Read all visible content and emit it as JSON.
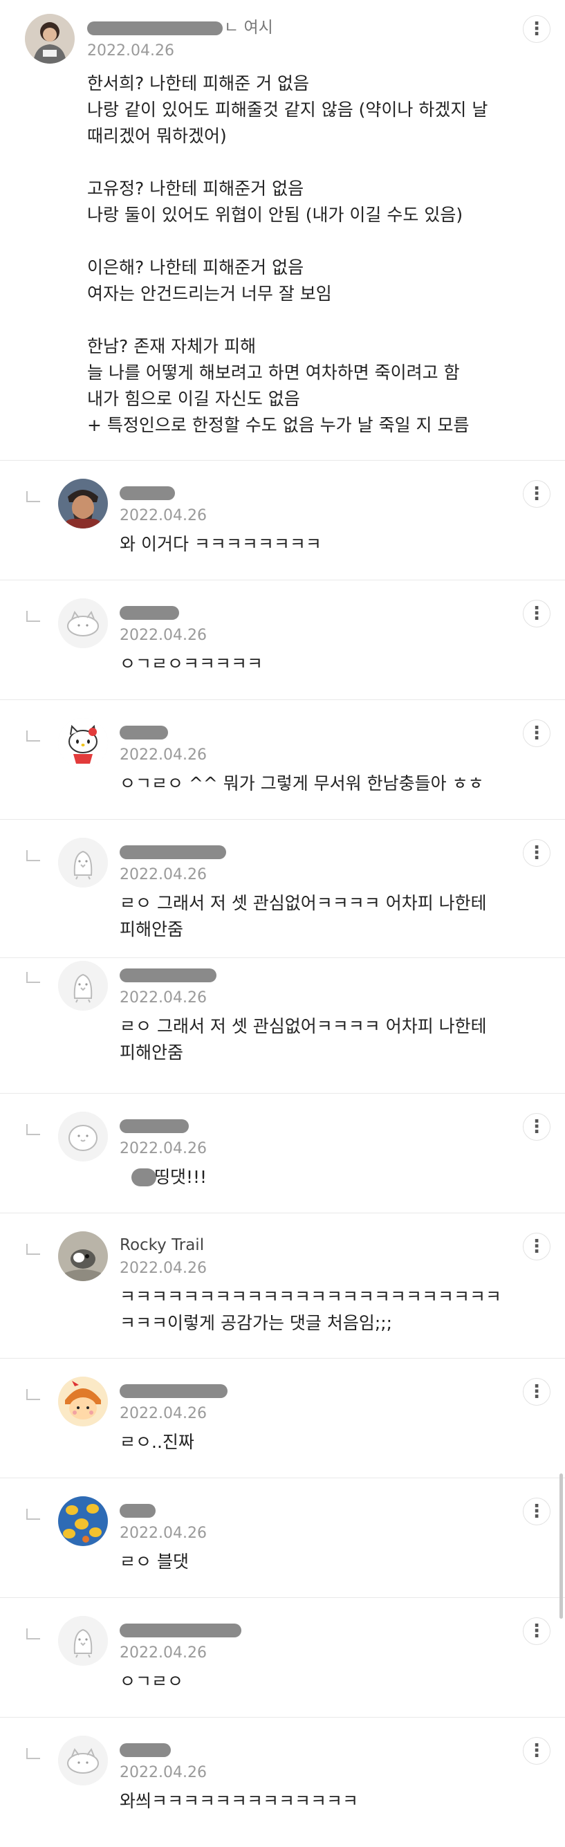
{
  "post": {
    "author_tail": "ㄴ 여시",
    "date": "2022.04.26",
    "lines": [
      "한서희? 나한테 피해준 거 없음",
      "나랑 같이 있어도 피해줄것 같지 않음 (약이나 하겠지 날",
      "때리겠어 뭐하겠어)",
      "",
      "고유정? 나한테 피해준거 없음",
      "나랑 둘이 있어도 위협이 안됨 (내가 이길 수도 있음)",
      "",
      "이은해? 나한테 피해준거 없음",
      "여자는 안건드리는거 너무 잘 보임",
      "",
      "한남? 존재 자체가 피해",
      "늘 나를 어떻게 해보려고 하면 여차하면 죽이려고 함",
      "내가 힘으로 이길 자신도 없음",
      "+ 특정인으로 한정할 수도 없음 누가 날 죽일 지 모름"
    ],
    "more_icon": "⋮"
  },
  "replies": [
    {
      "avatar": "man-photo-avatar",
      "nick_tail": "",
      "date": "2022.04.26",
      "lines": [
        "와 이거다 ㅋㅋㅋㅋㅋㅋㅋㅋ"
      ]
    },
    {
      "avatar": "cat-default-avatar",
      "nick_tail": "",
      "date": "2022.04.26",
      "lines": [
        "ㅇㄱㄹㅇㅋㅋㅋㅋㅋ"
      ]
    },
    {
      "avatar": "hello-kitty-avatar",
      "nick_tail": "",
      "date": "2022.04.26",
      "lines": [
        "ㅇㄱㄹㅇ ^^ 뭐가 그렇게 무서워 한남충들아 ㅎㅎ"
      ]
    },
    {
      "avatar": "penguin-default-avatar",
      "nick_tail": "",
      "date": "2022.04.26",
      "lines": [
        "ㄹㅇ 그래서 저 셋 관심없어ㅋㅋㅋㅋ 어차피 나한테",
        "피해안줌"
      ]
    },
    {
      "avatar": "penguin-default-avatar",
      "nick_tail": "",
      "date": "2022.04.26",
      "lines": [
        "ㄹㅇ 그래서 저 셋 관심없어ㅋㅋㅋㅋ 어차피 나한테",
        "피해안줌"
      ]
    },
    {
      "avatar": "seal-default-avatar",
      "nick_tail": "",
      "date": "2022.04.26",
      "lines": [
        "띵댓!!!"
      ]
    },
    {
      "avatar": "dog-photo-avatar",
      "nick_tail": "Rocky Trail",
      "date": "2022.04.26",
      "lines": [
        "ㅋㅋㅋㅋㅋㅋㅋㅋㅋㅋㅋㅋㅋㅋㅋㅋㅋㅋㅋㅋㅋㅋㅋㅋ",
        "ㅋㅋㅋ이렇게 공감가는 댓글 처음임;;;"
      ]
    },
    {
      "avatar": "character-avatar",
      "nick_tail": "",
      "date": "2022.04.26",
      "lines": [
        "ㄹㅇ..진짜"
      ]
    },
    {
      "avatar": "duck-pattern-avatar",
      "nick_tail": "",
      "date": "2022.04.26",
      "lines": [
        "ㄹㅇ 블댓"
      ]
    },
    {
      "avatar": "penguin-default-avatar",
      "nick_tail": "",
      "date": "2022.04.26",
      "lines": [
        "ㅇㄱㄹㅇ"
      ]
    },
    {
      "avatar": "cat-default-avatar",
      "nick_tail": "",
      "date": "2022.04.26",
      "lines": [
        "와씌ㅋㅋㅋㅋㅋㅋㅋㅋㅋㅋㅋㅋㅋ"
      ]
    }
  ]
}
